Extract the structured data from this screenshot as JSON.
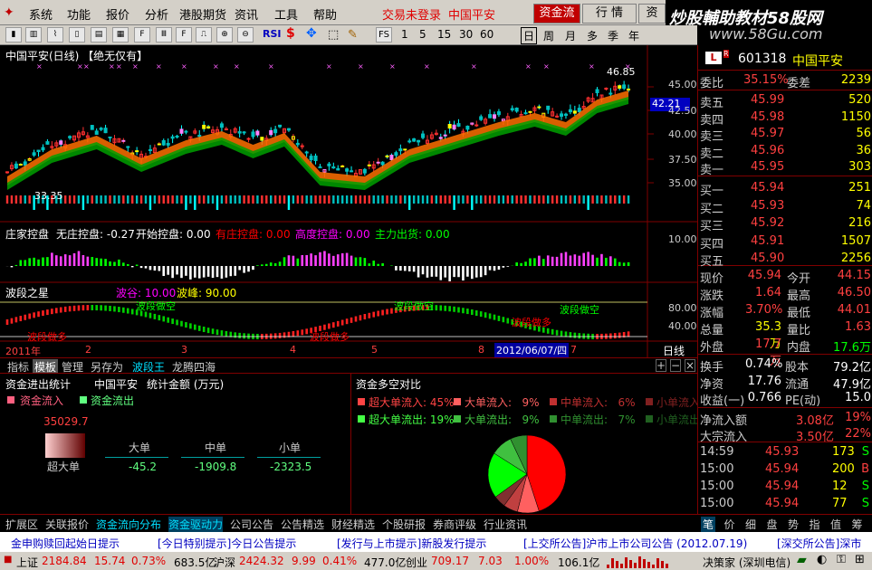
{
  "menu": {
    "items": [
      "系统",
      "功能",
      "报价",
      "分析",
      "港股期货",
      "资讯",
      "工具",
      "帮助"
    ],
    "login": "交易未登录",
    "stock": "中国平安",
    "tabs": [
      "资金流",
      "行 情",
      "资"
    ]
  },
  "watermark": {
    "line1": "炒股輔助教材58股网",
    "line2": "www.58Gu.com"
  },
  "toolbar": {
    "rsi": "RSI",
    "fs": "FS",
    "periods": [
      "1",
      "5",
      "15",
      "30",
      "60"
    ],
    "cycles": [
      "日",
      "周",
      "月",
      "多",
      "季",
      "年"
    ]
  },
  "chart": {
    "title": "中国平安(日线) 【绝无仅有】",
    "hi_label": "46.85",
    "lo_label": "33.35",
    "price_tag": "42.21",
    "y_ticks": [
      "45.00",
      "42.50",
      "40.00",
      "37.50",
      "35.00"
    ],
    "p2": {
      "name": "庄家控盘",
      "items": [
        {
          "t": "无庄控盘: -0.27",
          "c": "#ffffff"
        },
        {
          "t": "开始控盘: 0.00",
          "c": "#ffffff"
        },
        {
          "t": "有庄控盘: 0.00",
          "c": "#ff0000"
        },
        {
          "t": "高度控盘: 0.00",
          "c": "#ff00ff"
        },
        {
          "t": "主力出货: 0.00",
          "c": "#00ff00"
        }
      ],
      "y_tick": "10.00"
    },
    "p3": {
      "name": "波段之星",
      "items": [
        {
          "t": "波谷: 10.00",
          "c": "#ff00ff"
        },
        {
          "t": "波峰: 90.00",
          "c": "#ffff00"
        }
      ],
      "y_ticks": [
        "80.00",
        "40.00"
      ],
      "ann": [
        {
          "t": "波段做空",
          "c": "#00ff00"
        },
        {
          "t": "波段做空",
          "c": "#00ff00"
        },
        {
          "t": "波段做空",
          "c": "#00ff00"
        },
        {
          "t": "波段做多",
          "c": "#ff0000"
        },
        {
          "t": "波段做多",
          "c": "#ff0000"
        },
        {
          "t": "波段做多",
          "c": "#ff0000"
        }
      ]
    },
    "xaxis": [
      "2011年",
      "2",
      "3",
      "4",
      "5",
      "8",
      "2012/06/07/四",
      "7"
    ],
    "period_label": "日线"
  },
  "btabs": [
    "指标",
    "模板",
    "管理",
    "另存为",
    "波段王",
    "龙腾四海"
  ],
  "left_panel": {
    "title": "资金进出统计",
    "stock": "中国平安",
    "unit": "统计金额 (万元)",
    "legend_in": "资金流入",
    "legend_out": "资金流出",
    "big": "35029.7",
    "row_label": "超大单",
    "cols": [
      "大单",
      "中单",
      "小单"
    ],
    "vals": [
      "-45.2",
      "-1909.8",
      "-2323.5"
    ]
  },
  "right_panel": {
    "title": "资金多空对比",
    "legend": [
      {
        "t": "超大单流入: 45%",
        "c": "#ff4444"
      },
      {
        "t": "大单流入:   9%",
        "c": "#ff6060"
      },
      {
        "t": "中单流入:   6%",
        "c": "#c03030"
      },
      {
        "t": "小单流入",
        "c": "#802020"
      },
      {
        "t": "超大单流出: 19%",
        "c": "#44ff44"
      },
      {
        "t": "大单流出:   9%",
        "c": "#40c040"
      },
      {
        "t": "中单流出:   7%",
        "c": "#309030"
      },
      {
        "t": "小单流出",
        "c": "#206020"
      }
    ],
    "pie": [
      {
        "v": 45,
        "c": "#ff0000"
      },
      {
        "v": 9,
        "c": "#ff6060"
      },
      {
        "v": 6,
        "c": "#c04040"
      },
      {
        "v": 5,
        "c": "#803030"
      },
      {
        "v": 19,
        "c": "#00ff00"
      },
      {
        "v": 9,
        "c": "#40c040"
      },
      {
        "v": 7,
        "c": "#309030"
      }
    ]
  },
  "quote": {
    "code": "601318",
    "name": "中国平安",
    "wb": {
      "l": "委比",
      "v": "35.15%",
      "l2": "委差",
      "v2": "2239"
    },
    "asks": [
      {
        "l": "卖五",
        "p": "45.99",
        "q": "520"
      },
      {
        "l": "卖四",
        "p": "45.98",
        "q": "1150"
      },
      {
        "l": "卖三",
        "p": "45.97",
        "q": "56"
      },
      {
        "l": "卖二",
        "p": "45.96",
        "q": "36"
      },
      {
        "l": "卖一",
        "p": "45.95",
        "q": "303"
      }
    ],
    "bids": [
      {
        "l": "买一",
        "p": "45.94",
        "q": "251"
      },
      {
        "l": "买二",
        "p": "45.93",
        "q": "74"
      },
      {
        "l": "买三",
        "p": "45.92",
        "q": "216"
      },
      {
        "l": "买四",
        "p": "45.91",
        "q": "1507"
      },
      {
        "l": "买五",
        "p": "45.90",
        "q": "2256"
      }
    ],
    "stats": [
      {
        "l": "现价",
        "v": "45.94",
        "c": "#ff4040",
        "l2": "今开",
        "v2": "44.15",
        "c2": "#ff4040"
      },
      {
        "l": "涨跌",
        "v": "1.64",
        "c": "#ff4040",
        "l2": "最高",
        "v2": "46.50",
        "c2": "#ff4040"
      },
      {
        "l": "涨幅",
        "v": "3.70%",
        "c": "#ff4040",
        "l2": "最低",
        "v2": "44.01",
        "c2": "#ff4040"
      },
      {
        "l": "总量",
        "v": "35.3万",
        "c": "#ffff00",
        "l2": "量比",
        "v2": "1.63",
        "c2": "#ff4040"
      },
      {
        "l": "外盘",
        "v": "17.7万",
        "c": "#ff4040",
        "l2": "内盘",
        "v2": "17.6万",
        "c2": "#00ff00"
      }
    ],
    "stats2": [
      {
        "l": "换手",
        "v": "0.74%",
        "c": "#ffffff",
        "l2": "股本",
        "v2": "79.2亿",
        "c2": "#ffffff"
      },
      {
        "l": "净资",
        "v": "17.76",
        "c": "#ffffff",
        "l2": "流通",
        "v2": "47.9亿",
        "c2": "#ffffff"
      },
      {
        "l": "收益(一)",
        "v": "0.766",
        "c": "#ffffff",
        "l2": "PE(动)",
        "v2": "15.0",
        "c2": "#ffffff"
      }
    ],
    "flow": [
      {
        "l": "净流入额",
        "v": "3.08亿",
        "p": "19%"
      },
      {
        "l": "大宗流入",
        "v": "3.50亿",
        "p": "22%"
      }
    ],
    "ticks": [
      {
        "t": "14:59",
        "p": "45.93",
        "q": "173",
        "s": "S",
        "sc": "#00ff00"
      },
      {
        "t": "15:00",
        "p": "45.94",
        "q": "200",
        "s": "B",
        "sc": "#ff4040"
      },
      {
        "t": "15:00",
        "p": "45.94",
        "q": "12",
        "s": "S",
        "sc": "#00ff00"
      },
      {
        "t": "15:00",
        "p": "45.94",
        "q": "77",
        "s": "S",
        "sc": "#00ff00"
      }
    ],
    "tabs": [
      "笔",
      "价",
      "细",
      "盘",
      "势",
      "指",
      "值",
      "筹"
    ]
  },
  "bottom_tabs": [
    "扩展区",
    "关联报价",
    "资金流向分布",
    "资金驱动力",
    "公司公告",
    "公告精选",
    "财经精选",
    "个股研报",
    "券商评级",
    "行业资讯"
  ],
  "ticker": [
    "金申购赎回起始日提示",
    "[今日特别提示]今日公告提示",
    "[发行与上市提示]新股发行提示",
    "[上交所公告]沪市上市公司公告 (2012.07.19)",
    "[深交所公告]深市"
  ],
  "status": {
    "sh_l": "上证",
    "sh": "2184.84",
    "sh_c": "15.74",
    "sh_p": "0.73%",
    "sh_v": "683.5亿",
    "sz_l": "沪深",
    "sz": "2424.32",
    "sz_c": "9.99",
    "sz_p": "0.41%",
    "sz_v": "477.0亿",
    "cy_l": "创业",
    "cy": "709.17",
    "cy_c": "7.03",
    "cy_p": "1.00%",
    "cy_v": "106.1亿",
    "right": "决策家 (深圳电信)"
  },
  "colors": {
    "up": "#ff4040",
    "down": "#00ff00",
    "grid": "#800000",
    "yellow": "#ffff00"
  }
}
